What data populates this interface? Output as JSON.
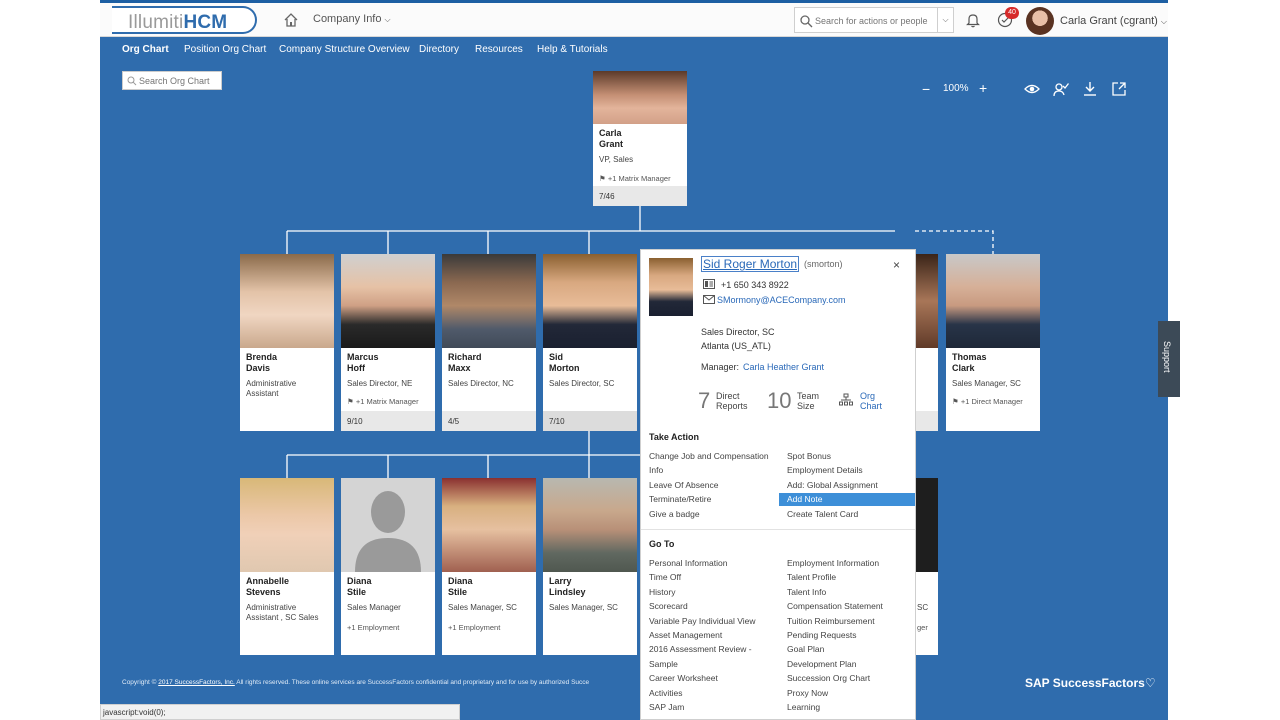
{
  "header": {
    "logo_main": "Illumiti",
    "logo_accent": "HCM",
    "company_menu": "Company Info",
    "search_placeholder": "Search for actions or people",
    "notification_count": "40",
    "user_name": "Carla Grant (cgrant)"
  },
  "nav": {
    "items": [
      {
        "label": "Org Chart"
      },
      {
        "label": "Position Org Chart"
      },
      {
        "label": "Company Structure Overview"
      },
      {
        "label": "Directory"
      },
      {
        "label": "Resources"
      },
      {
        "label": "Help & Tutorials"
      }
    ]
  },
  "org_search": {
    "placeholder": "Search Org Chart"
  },
  "zoom": {
    "level": "100%",
    "minus": "−",
    "plus": "+"
  },
  "top_card": {
    "first": "Carla",
    "last": "Grant",
    "role": "VP, Sales",
    "extra": "+1 Matrix Manager",
    "count": "7/46"
  },
  "row1": [
    {
      "first": "Brenda",
      "last": "Davis",
      "role": "Administrative Assistant",
      "extra": "",
      "count": ""
    },
    {
      "first": "Marcus",
      "last": "Hoff",
      "role": "Sales Director, NE",
      "extra": "+1 Matrix Manager",
      "count": "9/10"
    },
    {
      "first": "Richard",
      "last": "Maxx",
      "role": "Sales Director, NC",
      "extra": "",
      "count": "4/5"
    },
    {
      "first": "Sid",
      "last": "Morton",
      "role": "Sales Director, SC",
      "extra": "",
      "count": "7/10"
    },
    {
      "first": "Thomas",
      "last": "Clark",
      "role": "Sales Manager, SC",
      "extra": "+1 Direct Manager",
      "count": ""
    }
  ],
  "row2": [
    {
      "first": "Annabelle",
      "last": "Stevens",
      "role": "Administrative Assistant , SC Sales",
      "extra": ""
    },
    {
      "first": "Diana",
      "last": "Stile",
      "role": "Sales Manager",
      "extra": "+1 Employment"
    },
    {
      "first": "Diana",
      "last": "Stile",
      "role": "Sales Manager, SC",
      "extra": "+1 Employment"
    },
    {
      "first": "Larry",
      "last": "Lindsley",
      "role": "Sales Manager, SC",
      "extra": ""
    }
  ],
  "partial": {
    "row1_right": "",
    "row2_right_role": "SC",
    "row2_right_extra": "ger"
  },
  "popup": {
    "name": "Sid Roger Morton",
    "username": "(smorton)",
    "close": "×",
    "phone": "+1 650 343 8922",
    "email": "SMormony@ACECompany.com",
    "title": "Sales Director, SC",
    "location": "Atlanta (US_ATL)",
    "manager_label": "Manager:",
    "manager": "Carla Heather Grant",
    "direct_reports_num": "7",
    "direct_reports_label_1": "Direct",
    "direct_reports_label_2": "Reports",
    "team_size_num": "10",
    "team_size_label_1": "Team",
    "team_size_label_2": "Size",
    "org_chart_1": "Org",
    "org_chart_2": "Chart",
    "take_action_title": "Take Action",
    "take_action_left": [
      "Change Job and Compensation",
      "Info",
      "Leave Of Absence",
      "Terminate/Retire",
      "Give a badge"
    ],
    "take_action_right": [
      "Spot Bonus",
      "Employment Details",
      "Add: Global Assignment",
      "Add Note",
      "Create Talent Card"
    ],
    "goto_title": "Go To",
    "goto_left": [
      "Personal Information",
      "Time Off",
      "History",
      "Scorecard",
      "Variable Pay Individual View",
      "Asset Management",
      "2016 Assessment Review -",
      "Sample",
      "Career Worksheet",
      "Activities",
      "SAP Jam"
    ],
    "goto_right": [
      "Employment Information",
      "Talent Profile",
      "Talent Info",
      "Compensation Statement",
      "Tuition Reimbursement",
      "Pending Requests",
      "Goal Plan",
      "Development Plan",
      "Succession Org Chart",
      "Proxy Now",
      "Learning"
    ]
  },
  "footer": {
    "copyright_prefix": "Copyright ©",
    "copyright_link": "2017 SuccessFactors, Inc.",
    "copyright_suffix": "All rights reserved. These online services are SuccessFactors confidential and proprietary and for use by authorized Succe",
    "brand": "SAP SuccessFactors",
    "brand_heart": "♡",
    "support": "Support",
    "status": "javascript:void(0);"
  },
  "colors": {
    "background": "#2f6cad",
    "link": "#2a69b8",
    "highlight": "#3d8fd8",
    "badge": "#d62b2b"
  }
}
